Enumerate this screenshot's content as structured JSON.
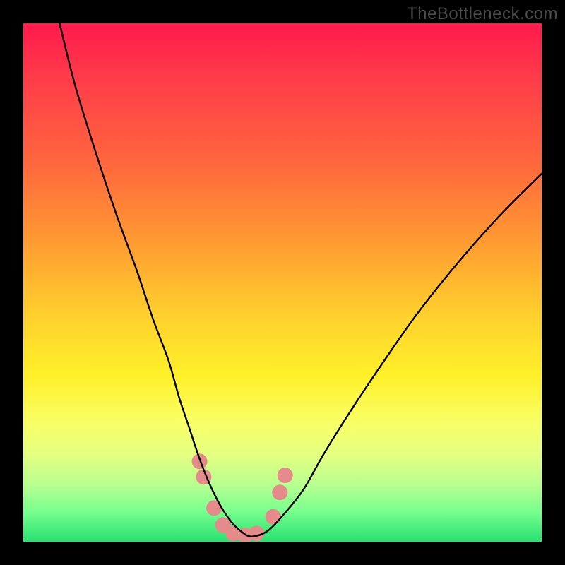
{
  "watermark": "TheBottleneck.com",
  "chart_data": {
    "type": "line",
    "title": "",
    "xlabel": "",
    "ylabel": "",
    "xlim": [
      0,
      100
    ],
    "ylim": [
      0,
      100
    ],
    "gradient_stops": [
      {
        "pos": 0,
        "color": "#ff1a4d"
      },
      {
        "pos": 10,
        "color": "#ff3a4a"
      },
      {
        "pos": 28,
        "color": "#ff6a3d"
      },
      {
        "pos": 42,
        "color": "#ff9a32"
      },
      {
        "pos": 56,
        "color": "#ffcf2e"
      },
      {
        "pos": 68,
        "color": "#fff02a"
      },
      {
        "pos": 77,
        "color": "#f8ff66"
      },
      {
        "pos": 83,
        "color": "#e6ff80"
      },
      {
        "pos": 89,
        "color": "#b8ff90"
      },
      {
        "pos": 94,
        "color": "#7aff8f"
      },
      {
        "pos": 100,
        "color": "#28e070"
      }
    ],
    "series": [
      {
        "name": "bottleneck-curve",
        "color": "#000000",
        "x": [
          7,
          10,
          14,
          18,
          22,
          25,
          28,
          30,
          32,
          34,
          36,
          38,
          40,
          42,
          44,
          47,
          50,
          54,
          58,
          63,
          69,
          76,
          84,
          92,
          100
        ],
        "y": [
          100,
          88,
          75,
          63,
          52,
          43,
          35,
          28,
          22,
          16,
          11,
          7,
          4,
          2,
          1,
          2,
          5,
          10,
          17,
          25,
          34,
          44,
          54,
          63,
          71
        ]
      }
    ],
    "markers": {
      "name": "highlight-beads",
      "color": "#e58a8a",
      "radius_px": 11,
      "points": [
        {
          "x": 34.0,
          "y": 15.5
        },
        {
          "x": 34.8,
          "y": 12.5
        },
        {
          "x": 36.8,
          "y": 6.5
        },
        {
          "x": 38.5,
          "y": 3.2
        },
        {
          "x": 40.5,
          "y": 1.6
        },
        {
          "x": 42.8,
          "y": 1.2
        },
        {
          "x": 45.0,
          "y": 1.6
        },
        {
          "x": 48.2,
          "y": 4.8
        },
        {
          "x": 49.5,
          "y": 9.5
        },
        {
          "x": 50.5,
          "y": 12.8
        }
      ]
    }
  }
}
